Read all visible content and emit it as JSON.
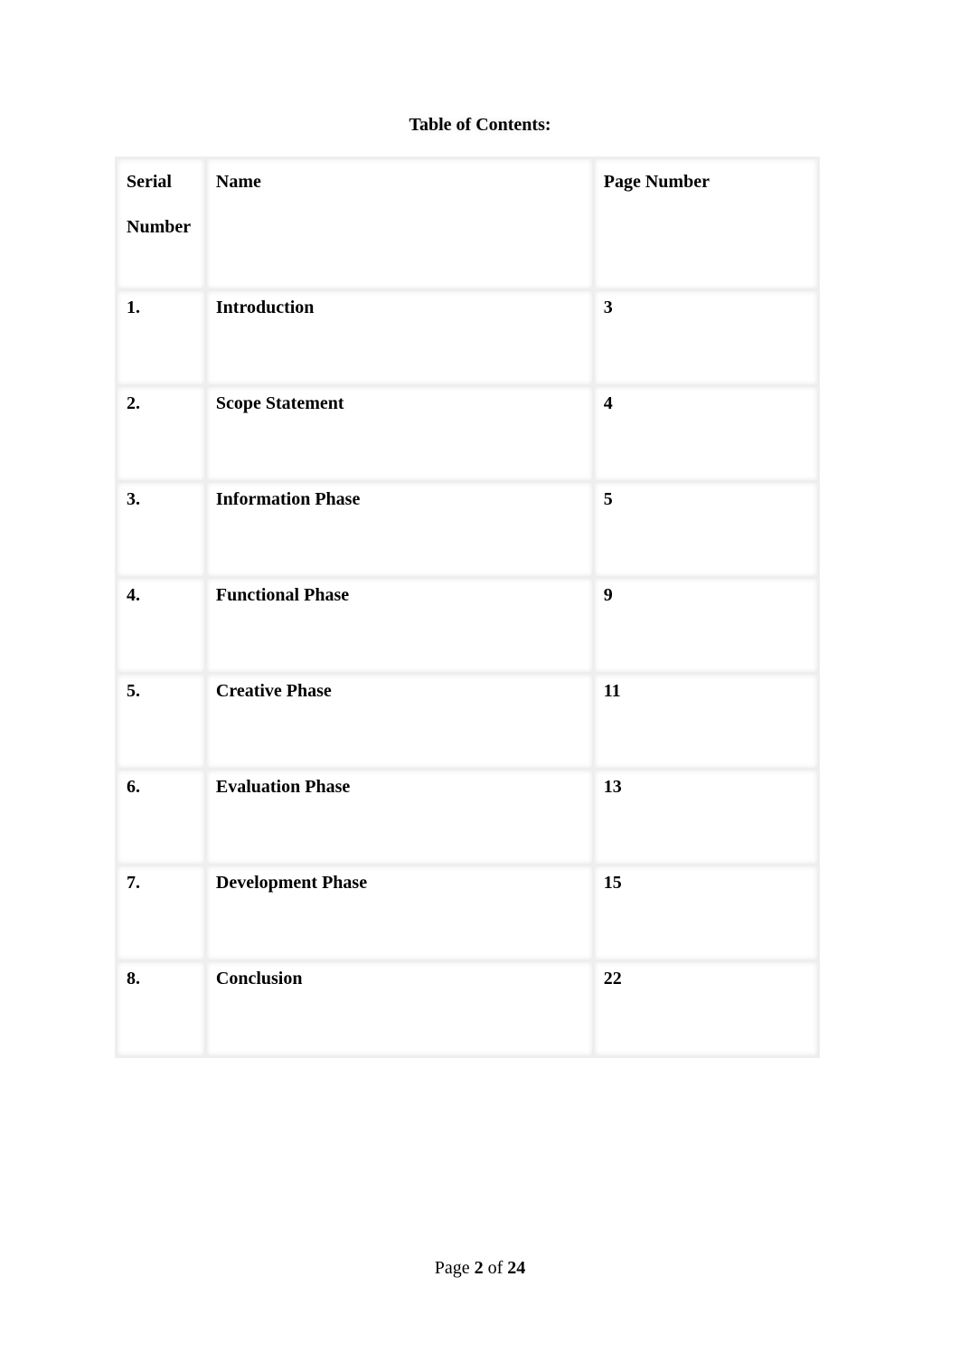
{
  "title": "Table of Contents:",
  "table": {
    "headers": {
      "serial_line1": "Serial",
      "serial_line2": "Number",
      "name": "Name",
      "page": "Page Number"
    },
    "rows": [
      {
        "serial": "1.",
        "name": "Introduction",
        "page": "3"
      },
      {
        "serial": "2.",
        "name": "Scope Statement",
        "page": "4"
      },
      {
        "serial": "3.",
        "name": "Information Phase",
        "page": "5"
      },
      {
        "serial": "4.",
        "name": "Functional Phase",
        "page": "9"
      },
      {
        "serial": "5.",
        "name": "Creative Phase",
        "page": "11"
      },
      {
        "serial": "6.",
        "name": "Evaluation Phase",
        "page": "13"
      },
      {
        "serial": "7.",
        "name": "Development Phase",
        "page": "15"
      },
      {
        "serial": "8.",
        "name": "Conclusion",
        "page": "22"
      }
    ]
  },
  "footer": {
    "prefix": "Page",
    "current": "2",
    "of": "of",
    "total": "24"
  }
}
